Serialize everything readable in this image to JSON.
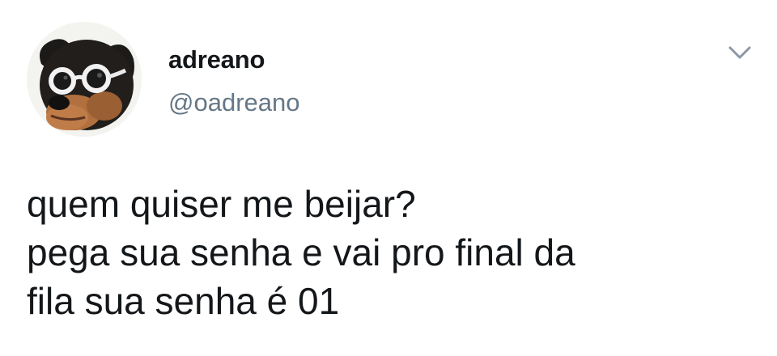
{
  "author": {
    "display_name": "adreano",
    "handle": "@oadreano",
    "avatar_icon": "dog-with-white-sunglasses-avatar"
  },
  "menu": {
    "icon": "chevron-down-icon"
  },
  "tweet": {
    "lines": [
      "quem quiser me beijar?",
      "pega sua senha e vai pro final da",
      "fila sua senha é 01"
    ]
  },
  "colors": {
    "text": "#14171a",
    "secondary": "#657786",
    "background": "#ffffff"
  }
}
